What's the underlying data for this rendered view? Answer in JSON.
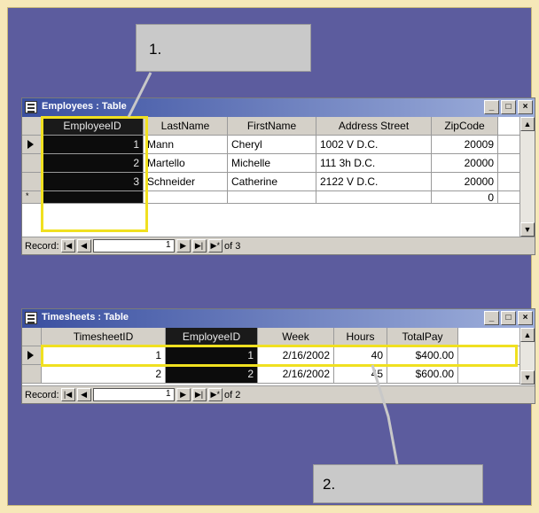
{
  "callouts": {
    "one": "1.",
    "two": "2."
  },
  "employees": {
    "title": "Employees : Table",
    "columns": [
      "EmployeeID",
      "LastName",
      "FirstName",
      "Address Street",
      "ZipCode"
    ],
    "rows": [
      [
        "1",
        "Mann",
        "Cheryl",
        "1002 V D.C.",
        "20009"
      ],
      [
        "2",
        "Martello",
        "Michelle",
        "111 3h D.C.",
        "20000"
      ],
      [
        "3",
        "Schneider",
        "Catherine",
        "2122 V D.C.",
        "20000"
      ],
      [
        "",
        "",
        "",
        "",
        "0"
      ]
    ],
    "nav": {
      "label": "Record:",
      "of_text": "of 3"
    }
  },
  "timesheets": {
    "title": "Timesheets : Table",
    "columns": [
      "TimesheetID",
      "EmployeeID",
      "Week",
      "Hours",
      "TotalPay"
    ],
    "rows": [
      [
        "1",
        "1",
        "2/16/2002",
        "40",
        "$400.00"
      ],
      [
        "2",
        "2",
        "2/16/2002",
        "45",
        "$600.00"
      ]
    ],
    "nav": {
      "label": "Record:",
      "of_text": "of 2"
    }
  },
  "colors": {
    "highlight": "#f0e020",
    "background": "#5c5c9e"
  },
  "icons": {
    "window_controls": [
      "minimize-icon",
      "restore-icon",
      "close-icon"
    ],
    "navigation": [
      "first-record-icon",
      "previous-record-icon",
      "next-record-icon",
      "last-record-icon",
      "new-record-icon"
    ]
  }
}
